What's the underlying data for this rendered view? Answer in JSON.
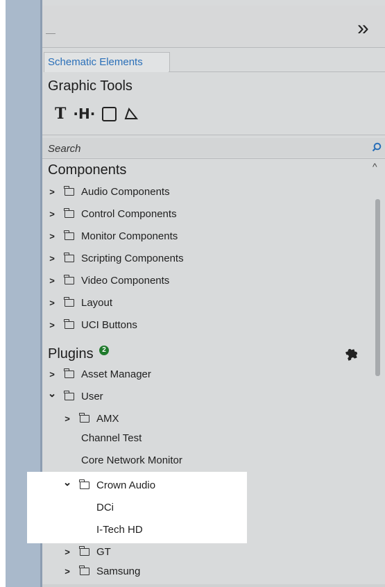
{
  "header": {
    "dash": "—",
    "expand_icon": "double-chevron-right-icon"
  },
  "tab": {
    "label": "Schematic Elements"
  },
  "graphic_tools": {
    "title": "Graphic Tools",
    "tools": [
      {
        "name": "text-tool-icon",
        "glyph": "T"
      },
      {
        "name": "net-label-tool-icon",
        "glyph": "·H·"
      },
      {
        "name": "rectangle-tool-icon",
        "glyph": ""
      },
      {
        "name": "line-tool-icon",
        "glyph": ""
      }
    ]
  },
  "search": {
    "placeholder": "Search"
  },
  "components": {
    "title": "Components",
    "items": [
      {
        "label": "Audio Components"
      },
      {
        "label": "Control Components"
      },
      {
        "label": "Monitor Components"
      },
      {
        "label": "Scripting Components"
      },
      {
        "label": "Video Components"
      },
      {
        "label": "Layout"
      },
      {
        "label": "UCI Buttons"
      }
    ]
  },
  "plugins": {
    "title": "Plugins",
    "badge": "2",
    "items": [
      {
        "label": "Asset Manager",
        "level": 0,
        "expanded": false
      },
      {
        "label": "User",
        "level": 0,
        "expanded": true
      },
      {
        "label": "AMX",
        "level": 1,
        "expanded": false
      },
      {
        "label": "Channel Test",
        "level": 2
      },
      {
        "label": "Core Network Monitor",
        "level": 2
      },
      {
        "label": "Crown Audio",
        "level": 1,
        "expanded": true
      },
      {
        "label": "DCi",
        "level": 2
      },
      {
        "label": "I-Tech HD",
        "level": 2
      },
      {
        "label": "GT",
        "level": 1,
        "expanded": false
      },
      {
        "label": "Samsung",
        "level": 1,
        "expanded": false
      }
    ]
  }
}
